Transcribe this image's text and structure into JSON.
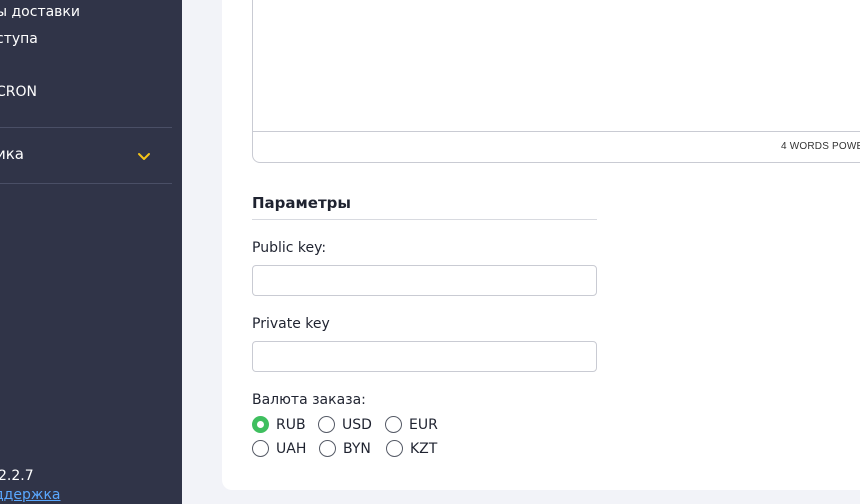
{
  "sidebar": {
    "items": [
      {
        "label": "ы доставки"
      },
      {
        "label": "ступа"
      },
      {
        "label": "CRON"
      },
      {
        "label": "ика"
      }
    ],
    "version": "2.2.7",
    "support_link": "ддержка",
    "accent_color": "#f5c518"
  },
  "editor": {
    "word_count": "4 WORDS POWE"
  },
  "params": {
    "title": "Параметры",
    "public_key": {
      "label": "Public key:",
      "value": "",
      "placeholder": ""
    },
    "private_key": {
      "label": "Private key",
      "value": "",
      "placeholder": ""
    },
    "currency": {
      "label": "Валюта заказа:",
      "options": [
        "RUB",
        "USD",
        "EUR",
        "UAH",
        "BYN",
        "KZT"
      ],
      "selected": "RUB",
      "selected_color": "#3fbf5f"
    }
  }
}
